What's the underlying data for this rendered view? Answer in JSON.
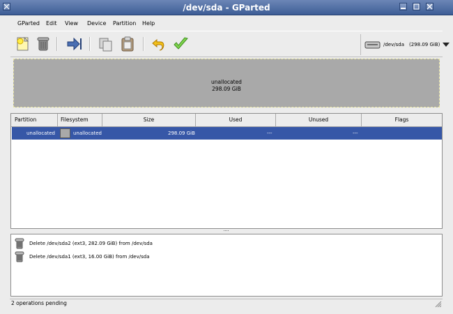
{
  "window": {
    "title": "/dev/sda - GParted"
  },
  "menu": [
    "GParted",
    "Edit",
    "View",
    "Device",
    "Partition",
    "Help"
  ],
  "toolbar": {
    "icons": [
      "new-icon",
      "delete-icon",
      "resize-icon",
      "copy-icon",
      "paste-icon",
      "undo-icon",
      "apply-icon"
    ]
  },
  "device": {
    "name": "/dev/sda",
    "size": "(298.09 GiB)"
  },
  "visual": {
    "label": "unallocated",
    "size": "298.09 GiB"
  },
  "table": {
    "headers": [
      "Partition",
      "Filesystem",
      "Size",
      "Used",
      "Unused",
      "Flags"
    ],
    "rows": [
      {
        "partition": "unallocated",
        "filesystem": "unallocated",
        "size": "298.09 GiB",
        "used": "---",
        "unused": "---",
        "flags": ""
      }
    ]
  },
  "operations": [
    "Delete /dev/sda2 (ext3, 282.09 GiB) from /dev/sda",
    "Delete /dev/sda1 (ext3, 16.00 GiB) from /dev/sda"
  ],
  "status": "2 operations pending"
}
